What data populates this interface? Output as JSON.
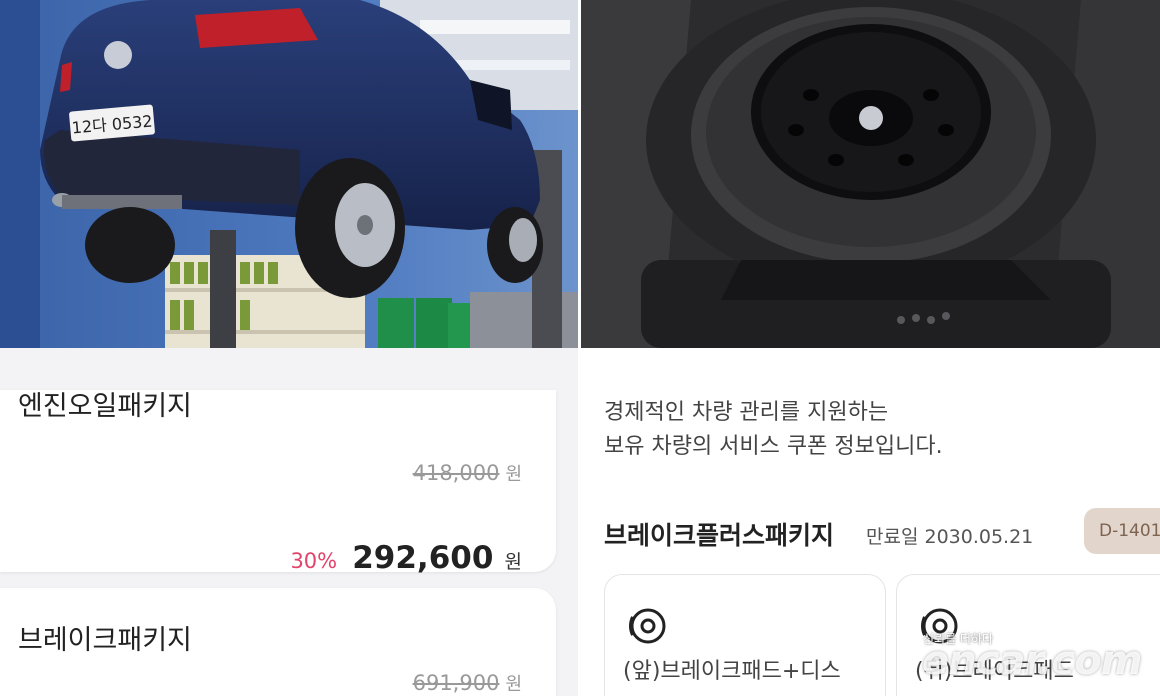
{
  "left_list": {
    "items": [
      {
        "title": "엔진오일패키지",
        "original_price": "418,000",
        "currency": "원",
        "discount": "30%",
        "sale_price": "292,600"
      },
      {
        "title": "브레이크패키지",
        "original_price": "691,900",
        "currency": "원"
      }
    ]
  },
  "coupon": {
    "intro_line1": "경제적인 차량 관리를 지원하는",
    "intro_line2": "보유 차량의 서비스 쿠폰 정보입니다.",
    "package_title": "브레이크플러스패키지",
    "expiry": "만료일 2030.05.21",
    "dday": "D-1401",
    "services": [
      {
        "label": "(앞)브레이크패드+디스",
        "icon": "brake-disc-icon"
      },
      {
        "label": "(뒤)브레이크패드",
        "icon": "brake-disc-icon"
      }
    ]
  },
  "photos": {
    "car_plate": "12다 0532"
  },
  "watermark": {
    "tagline": "신뢰를 더하다",
    "brand": "encar.com"
  },
  "colors": {
    "discount": "#e0446a",
    "dday_bg": "#e2d6cc",
    "dday_text": "#7d6350"
  }
}
